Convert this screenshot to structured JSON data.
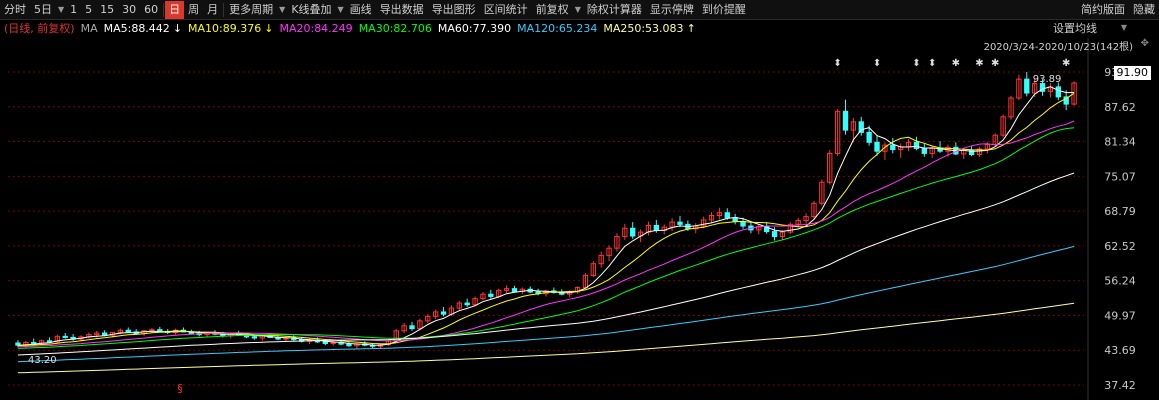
{
  "toolbar": {
    "items": [
      "分时",
      "5日",
      "1",
      "5",
      "15",
      "30",
      "60",
      "日",
      "周",
      "月",
      "更多周期",
      "K线叠加",
      "画线",
      "导出数据",
      "导出图形",
      "区间统计",
      "前复权",
      "除权计算器",
      "显示停牌",
      "到价提醒"
    ],
    "selected": "日",
    "right_items": [
      "简约版面",
      "隐藏"
    ]
  },
  "legend": {
    "period_label": "(日线, 前复权)",
    "ma_label": "MA",
    "ma5": "MA5:88.442",
    "ma10": "MA10:89.376",
    "ma20": "MA20:84.249",
    "ma30": "MA30:82.706",
    "ma60": "MA60:77.390",
    "ma120": "MA120:65.234",
    "ma250": "MA250:53.083",
    "arrow_down": "↓",
    "arrow_up": "↑"
  },
  "set_ma_button": "设置均线",
  "range_text": "2020/3/24-2020/10/23(142根)",
  "current_price": "91.90",
  "colors": {
    "up": "#ff3333",
    "down": "#33ffff",
    "ma5": "#ffffff",
    "ma10": "#ffff00",
    "ma20": "#ff33ff",
    "ma30": "#00ff00",
    "ma60": "#ffffff",
    "ma120": "#33ccff",
    "ma250": "#ffff99",
    "grid": "#7a0000"
  },
  "chart_data": {
    "type": "candlestick",
    "y_ticks": [
      "93.89",
      "87.62",
      "81.34",
      "75.07",
      "68.79",
      "62.52",
      "56.24",
      "49.97",
      "43.69",
      "37.42"
    ],
    "ylim": [
      37.42,
      93.89
    ],
    "high_label": "93.89",
    "low_label": "43.20",
    "last_close": 91.9,
    "candles": [
      [
        45.0,
        45.5,
        44.2,
        44.6
      ],
      [
        44.6,
        45.4,
        44.0,
        45.1
      ],
      [
        45.1,
        45.8,
        44.8,
        45.0
      ],
      [
        45.0,
        45.6,
        44.6,
        45.4
      ],
      [
        45.4,
        46.0,
        45.0,
        45.2
      ],
      [
        45.2,
        46.5,
        45.0,
        46.2
      ],
      [
        46.2,
        46.8,
        45.8,
        46.0
      ],
      [
        46.0,
        46.6,
        45.4,
        45.7
      ],
      [
        45.7,
        46.4,
        45.3,
        46.1
      ],
      [
        46.1,
        46.9,
        45.8,
        46.5
      ],
      [
        46.5,
        47.2,
        46.0,
        46.8
      ],
      [
        46.8,
        47.3,
        46.2,
        46.4
      ],
      [
        46.4,
        47.0,
        46.0,
        46.9
      ],
      [
        46.9,
        47.6,
        46.6,
        47.3
      ],
      [
        47.3,
        47.8,
        46.8,
        47.0
      ],
      [
        47.0,
        47.5,
        46.5,
        46.7
      ],
      [
        46.7,
        47.4,
        46.3,
        47.2
      ],
      [
        47.2,
        47.7,
        46.8,
        47.4
      ],
      [
        47.4,
        47.9,
        47.0,
        47.1
      ],
      [
        47.1,
        47.5,
        46.6,
        46.9
      ],
      [
        46.9,
        47.6,
        46.5,
        47.3
      ],
      [
        47.3,
        47.8,
        46.9,
        47.0
      ],
      [
        47.0,
        47.4,
        46.5,
        46.7
      ],
      [
        46.7,
        47.2,
        46.2,
        46.5
      ],
      [
        46.5,
        47.0,
        46.0,
        46.8
      ],
      [
        46.8,
        47.3,
        46.4,
        46.6
      ],
      [
        46.6,
        47.0,
        46.0,
        46.3
      ],
      [
        46.3,
        46.9,
        45.8,
        46.7
      ],
      [
        46.7,
        47.2,
        46.3,
        46.5
      ],
      [
        46.5,
        46.9,
        45.9,
        46.1
      ],
      [
        46.1,
        46.6,
        45.6,
        45.9
      ],
      [
        45.9,
        46.5,
        45.4,
        46.3
      ],
      [
        46.3,
        46.8,
        45.9,
        46.0
      ],
      [
        46.0,
        46.4,
        45.5,
        45.7
      ],
      [
        45.7,
        46.2,
        45.2,
        45.9
      ],
      [
        45.9,
        46.4,
        45.4,
        45.6
      ],
      [
        45.6,
        46.0,
        45.1,
        45.3
      ],
      [
        45.3,
        45.8,
        44.8,
        45.5
      ],
      [
        45.5,
        46.0,
        45.0,
        45.2
      ],
      [
        45.2,
        45.6,
        44.6,
        44.9
      ],
      [
        44.9,
        45.4,
        44.5,
        45.1
      ],
      [
        45.1,
        45.6,
        44.6,
        44.8
      ],
      [
        44.8,
        45.2,
        44.3,
        44.5
      ],
      [
        44.5,
        45.0,
        44.0,
        44.8
      ],
      [
        44.8,
        45.3,
        44.4,
        44.6
      ],
      [
        44.6,
        45.0,
        44.1,
        44.4
      ],
      [
        44.4,
        44.9,
        43.9,
        44.7
      ],
      [
        44.7,
        45.6,
        44.5,
        45.4
      ],
      [
        45.4,
        47.5,
        45.2,
        47.2
      ],
      [
        47.2,
        48.6,
        46.8,
        48.1
      ],
      [
        48.1,
        48.8,
        47.2,
        47.6
      ],
      [
        47.6,
        49.4,
        47.3,
        49.0
      ],
      [
        49.0,
        50.2,
        48.6,
        49.8
      ],
      [
        49.8,
        51.0,
        49.3,
        50.6
      ],
      [
        50.6,
        51.5,
        49.8,
        50.2
      ],
      [
        50.2,
        51.8,
        49.9,
        51.3
      ],
      [
        51.3,
        52.6,
        50.9,
        52.2
      ],
      [
        52.2,
        53.0,
        51.5,
        51.9
      ],
      [
        51.9,
        53.4,
        51.6,
        53.0
      ],
      [
        53.0,
        54.2,
        52.7,
        53.8
      ],
      [
        53.8,
        54.6,
        53.0,
        53.4
      ],
      [
        53.4,
        54.8,
        53.1,
        54.5
      ],
      [
        54.5,
        55.4,
        54.0,
        54.8
      ],
      [
        54.8,
        55.3,
        54.1,
        54.3
      ],
      [
        54.3,
        55.0,
        53.8,
        54.7
      ],
      [
        54.7,
        55.2,
        54.0,
        54.2
      ],
      [
        54.2,
        54.8,
        53.6,
        53.9
      ],
      [
        53.9,
        54.6,
        53.4,
        54.4
      ],
      [
        54.4,
        55.0,
        53.9,
        54.1
      ],
      [
        54.1,
        54.7,
        53.6,
        53.8
      ],
      [
        53.8,
        54.5,
        53.3,
        54.2
      ],
      [
        54.2,
        55.2,
        53.9,
        55.0
      ],
      [
        55.0,
        57.6,
        54.8,
        57.2
      ],
      [
        57.2,
        59.8,
        56.9,
        59.3
      ],
      [
        59.3,
        61.5,
        58.6,
        60.8
      ],
      [
        60.8,
        62.6,
        59.8,
        62.1
      ],
      [
        62.1,
        64.8,
        61.5,
        64.2
      ],
      [
        64.2,
        66.5,
        63.6,
        65.7
      ],
      [
        65.7,
        66.8,
        63.8,
        64.3
      ],
      [
        64.3,
        65.5,
        63.2,
        65.0
      ],
      [
        65.0,
        66.9,
        64.4,
        66.2
      ],
      [
        66.2,
        67.2,
        64.9,
        65.3
      ],
      [
        65.3,
        66.4,
        64.6,
        65.9
      ],
      [
        65.9,
        67.5,
        65.2,
        66.8
      ],
      [
        66.8,
        67.9,
        65.9,
        66.4
      ],
      [
        66.4,
        67.1,
        65.2,
        65.6
      ],
      [
        65.6,
        66.6,
        64.8,
        66.1
      ],
      [
        66.1,
        67.8,
        65.7,
        67.2
      ],
      [
        67.2,
        68.6,
        66.6,
        68.0
      ],
      [
        68.0,
        69.4,
        67.3,
        68.5
      ],
      [
        68.5,
        69.3,
        67.2,
        67.6
      ],
      [
        67.6,
        68.3,
        66.4,
        66.9
      ],
      [
        66.9,
        67.6,
        65.6,
        66.1
      ],
      [
        66.1,
        66.8,
        64.8,
        65.4
      ],
      [
        65.4,
        66.5,
        64.6,
        66.0
      ],
      [
        66.0,
        66.8,
        64.7,
        65.1
      ],
      [
        65.1,
        65.9,
        63.5,
        64.2
      ],
      [
        64.2,
        65.4,
        63.6,
        65.0
      ],
      [
        65.0,
        66.8,
        64.7,
        66.4
      ],
      [
        66.4,
        67.6,
        65.8,
        67.1
      ],
      [
        67.1,
        68.4,
        66.5,
        67.8
      ],
      [
        67.8,
        70.6,
        67.4,
        70.2
      ],
      [
        70.2,
        74.5,
        69.8,
        74.0
      ],
      [
        74.0,
        79.8,
        73.6,
        79.2
      ],
      [
        79.2,
        87.2,
        78.7,
        86.8
      ],
      [
        86.8,
        88.9,
        82.6,
        83.4
      ],
      [
        83.4,
        85.6,
        81.2,
        84.9
      ],
      [
        84.9,
        85.8,
        82.4,
        83.0
      ],
      [
        83.0,
        84.2,
        80.6,
        81.2
      ],
      [
        81.2,
        82.5,
        78.8,
        79.6
      ],
      [
        79.6,
        81.2,
        78.0,
        80.7
      ],
      [
        80.7,
        82.0,
        79.2,
        79.9
      ],
      [
        79.9,
        81.0,
        78.4,
        80.4
      ],
      [
        80.4,
        81.8,
        79.6,
        81.2
      ],
      [
        81.2,
        82.2,
        79.8,
        80.1
      ],
      [
        80.1,
        81.0,
        78.6,
        79.2
      ],
      [
        79.2,
        80.6,
        78.4,
        80.1
      ],
      [
        80.1,
        81.4,
        79.3,
        79.6
      ],
      [
        79.6,
        80.8,
        78.6,
        80.3
      ],
      [
        80.3,
        81.2,
        78.9,
        79.1
      ],
      [
        79.1,
        80.2,
        78.2,
        79.8
      ],
      [
        79.8,
        80.6,
        78.7,
        79.0
      ],
      [
        79.0,
        80.4,
        78.6,
        80.0
      ],
      [
        80.0,
        81.2,
        79.2,
        80.8
      ],
      [
        80.8,
        82.8,
        80.5,
        82.5
      ],
      [
        82.5,
        86.2,
        82.1,
        85.8
      ],
      [
        85.8,
        89.6,
        85.3,
        89.2
      ],
      [
        89.2,
        93.4,
        88.8,
        92.6
      ],
      [
        92.6,
        93.9,
        89.5,
        90.1
      ],
      [
        90.1,
        92.8,
        89.4,
        91.8
      ],
      [
        91.8,
        92.6,
        89.6,
        90.4
      ],
      [
        90.4,
        91.9,
        89.3,
        91.2
      ],
      [
        91.2,
        92.0,
        88.8,
        89.4
      ],
      [
        89.4,
        90.6,
        87.0,
        88.1
      ],
      [
        88.1,
        92.2,
        87.8,
        91.9
      ]
    ],
    "moving_averages": {
      "ma5_end": 88.442,
      "ma10_end": 89.376,
      "ma20_end": 84.249,
      "ma30_end": 82.706,
      "ma60_end": 77.39,
      "ma120_end": 65.234,
      "ma250_end": 53.083
    },
    "markers": [
      "⬍",
      "⬍",
      "⬍",
      "⬍",
      "✱",
      "✱",
      "✱",
      "✱"
    ],
    "low_marker": "§"
  }
}
